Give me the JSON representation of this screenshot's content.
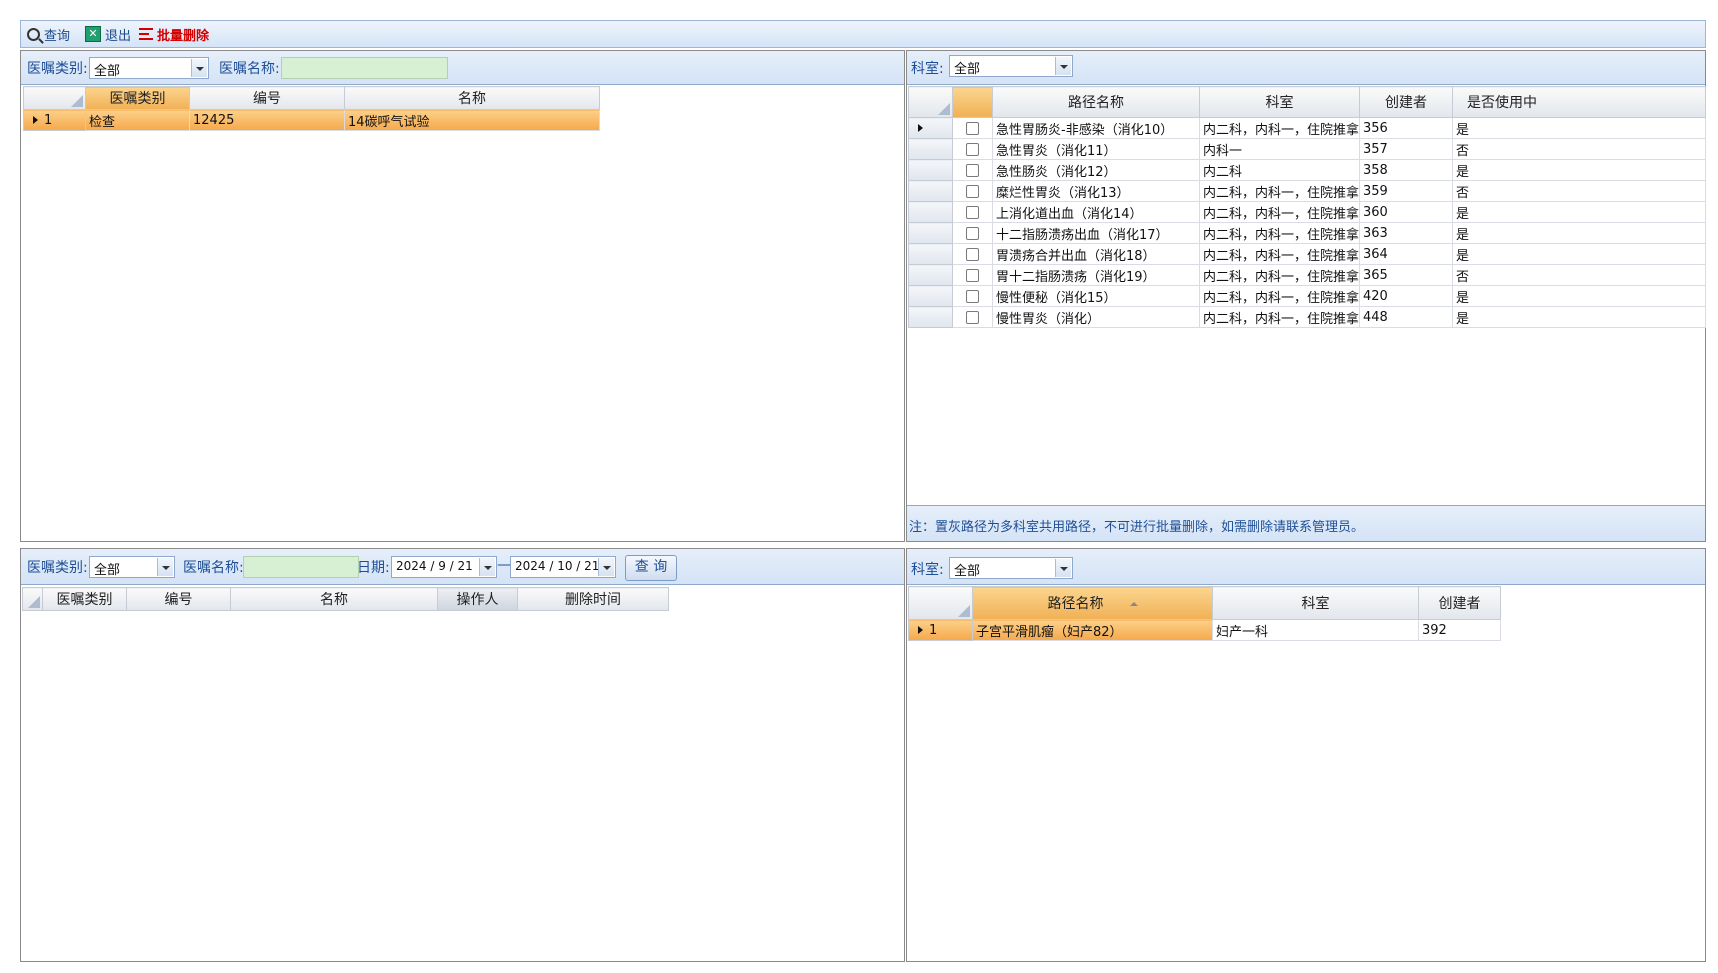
{
  "toolbar": {
    "query": "查询",
    "exit": "退出",
    "batch_delete": "批量删除"
  },
  "top_left": {
    "category_label": "医嘱类别:",
    "category_value": "全部",
    "name_label": "医嘱名称:",
    "name_value": "",
    "columns": [
      "医嘱类别",
      "编号",
      "名称"
    ],
    "rows": [
      {
        "num": "1",
        "category": "检查",
        "code": "12425",
        "name": "14碳呼气试验"
      }
    ]
  },
  "top_right": {
    "dept_label": "科室:",
    "dept_value": "全部",
    "columns": [
      "路径名称",
      "科室",
      "创建者",
      "是否使用中"
    ],
    "rows": [
      {
        "path": "急性胃肠炎-非感染（消化10）",
        "dept": "内二科，内科一，住院推拿科",
        "creator": "356",
        "in_use": "是"
      },
      {
        "path": "急性胃炎（消化11）",
        "dept": "内科一",
        "creator": "357",
        "in_use": "否"
      },
      {
        "path": "急性肠炎（消化12）",
        "dept": "内二科",
        "creator": "358",
        "in_use": "是"
      },
      {
        "path": "糜烂性胃炎（消化13）",
        "dept": "内二科，内科一，住院推拿科",
        "creator": "359",
        "in_use": "否"
      },
      {
        "path": "上消化道出血（消化14）",
        "dept": "内二科，内科一，住院推拿科",
        "creator": "360",
        "in_use": "是"
      },
      {
        "path": "十二指肠溃疡出血（消化17）",
        "dept": "内二科，内科一，住院推拿科",
        "creator": "363",
        "in_use": "是"
      },
      {
        "path": "胃溃疡合并出血（消化18）",
        "dept": "内二科，内科一，住院推拿科",
        "creator": "364",
        "in_use": "是"
      },
      {
        "path": "胃十二指肠溃疡（消化19）",
        "dept": "内二科，内科一，住院推拿科",
        "creator": "365",
        "in_use": "否"
      },
      {
        "path": "慢性便秘（消化15）",
        "dept": "内二科，内科一，住院推拿科",
        "creator": "420",
        "in_use": "是"
      },
      {
        "path": "慢性胃炎（消化）",
        "dept": "内二科，内科一，住院推拿科",
        "creator": "448",
        "in_use": "是"
      }
    ],
    "note": "注：置灰路径为多科室共用路径，不可进行批量删除，如需删除请联系管理员。"
  },
  "bottom_left": {
    "category_label": "医嘱类别:",
    "category_value": "全部",
    "name_label": "医嘱名称:",
    "name_value": "",
    "date_label": "日期:",
    "date_from": "2024 / 9 / 21",
    "date_sep": "—",
    "date_to": "2024 / 10 / 21",
    "query_button": "查 询",
    "columns": [
      "医嘱类别",
      "编号",
      "名称",
      "操作人",
      "删除时间"
    ],
    "rows": []
  },
  "bottom_right": {
    "dept_label": "科室:",
    "dept_value": "全部",
    "columns": [
      "路径名称",
      "科室",
      "创建者"
    ],
    "rows": [
      {
        "num": "1",
        "path": "子宫平滑肌瘤（妇产82）",
        "dept": "妇产一科",
        "creator": "392"
      }
    ]
  }
}
